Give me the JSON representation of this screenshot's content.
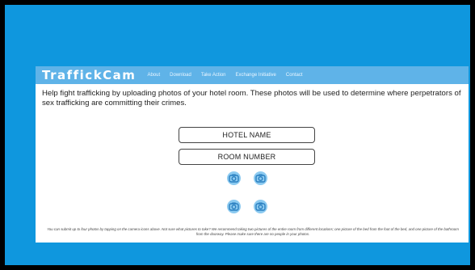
{
  "brand": "TraffickCam",
  "nav": [
    "About",
    "Download",
    "Take Action",
    "Exchange Initiative",
    "Contact"
  ],
  "intro": "Help fight trafficking by uploading photos of your hotel room. These photos will be used to determine where perpetrators of sex trafficking are committing their crimes.",
  "fields": {
    "hotel_name": "HOTEL NAME",
    "room_number": "ROOM NUMBER"
  },
  "camera_icons": [
    "camera-icon",
    "camera-icon",
    "camera-icon",
    "camera-icon"
  ],
  "footnote": "You can submit up to four photos by tapping on the camera icons above. Not sure what pictures to take? We recommend taking two pictures of the entire room from different locations; one picture of the bed from the foot of the bed, and one picture of the bathroom from the doorway. Please make sure there are no people in your photos.",
  "colors": {
    "slide_bg": "#0f97de",
    "navbar": "#5fb3e8",
    "camera_fill": "#8ccaf0",
    "camera_stroke": "#2a7fc0"
  }
}
